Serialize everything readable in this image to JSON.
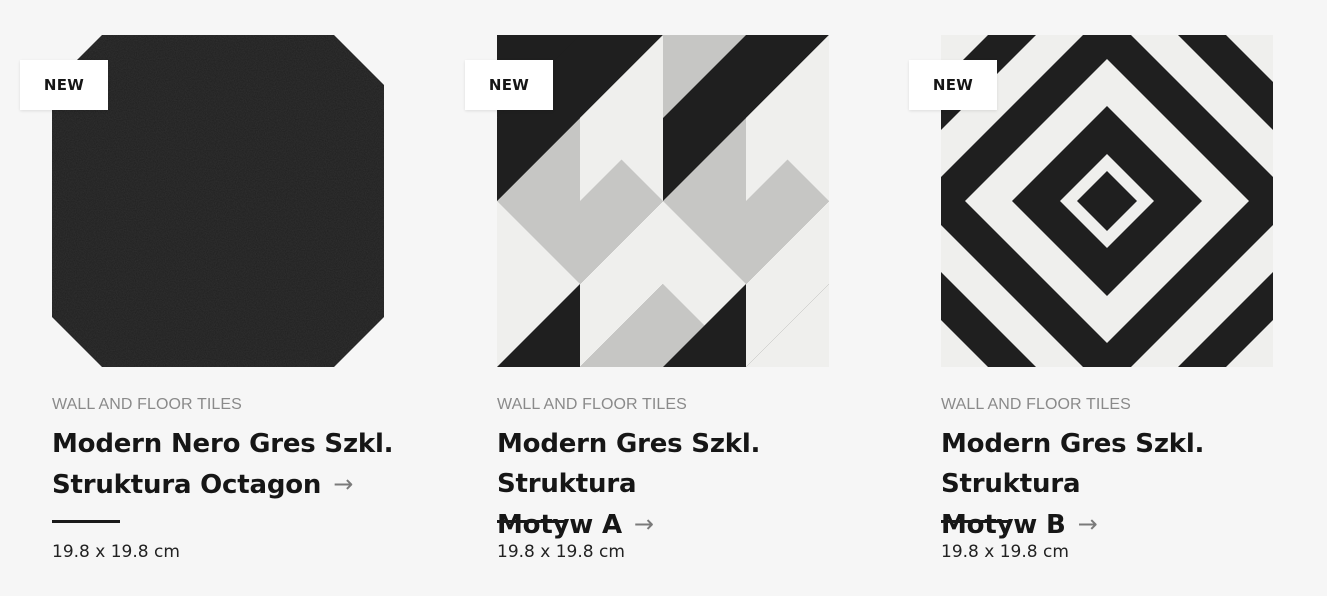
{
  "products": [
    {
      "badge": "NEW",
      "category": "WALL AND FLOOR TILES",
      "title_line1": "Modern Nero Gres Szkl.",
      "title_line2": "Struktura Octagon",
      "size": "19.8 x 19.8 cm",
      "pattern": "octagon-black"
    },
    {
      "badge": "NEW",
      "category": "WALL AND FLOOR TILES",
      "title_line1": "Modern Gres Szkl. Struktura",
      "title_line2": "Motyw A",
      "size": "19.8 x 19.8 cm",
      "pattern": "isometric-cubes"
    },
    {
      "badge": "NEW",
      "category": "WALL AND FLOOR TILES",
      "title_line1": "Modern Gres Szkl. Struktura",
      "title_line2": "Motyw B",
      "size": "19.8 x 19.8 cm",
      "pattern": "concentric-diamonds"
    }
  ],
  "icons": {
    "arrow": "→",
    "arrow_name": "arrow-right-icon"
  },
  "colors": {
    "background": "#f6f6f6",
    "tile_black": "#1f1f1f",
    "tile_white": "#efefed",
    "tile_grey": "#c4c4c2",
    "category_text": "#8a8a8a",
    "title_text": "#161616"
  }
}
